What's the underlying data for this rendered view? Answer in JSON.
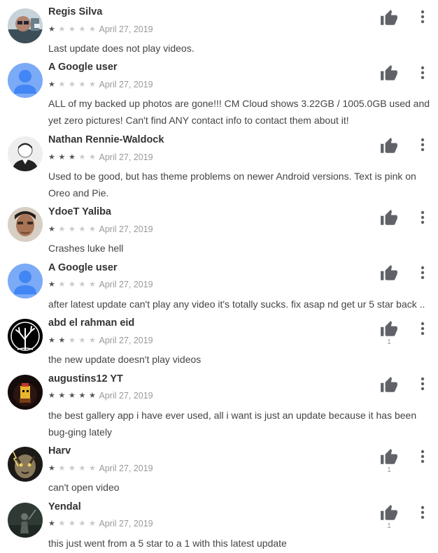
{
  "colors": {
    "author_text": "#333333",
    "body_text": "#444444",
    "date_text": "#9a9a9a",
    "star_filled": "#555555",
    "star_empty": "#c8c8c8",
    "icon": "#5f6368",
    "google_avatar_bg": "#7baaf7",
    "google_avatar_fg": "#4285f4"
  },
  "icons": {
    "thumb": "thumb-up-icon",
    "more": "more-vert-icon",
    "star_filled": "★",
    "star_empty": "★"
  },
  "reviews": [
    {
      "author": "Regis Silva",
      "rating": 1,
      "date": "April 27, 2019",
      "text": "Last update does not play videos.",
      "helpful_count": "",
      "avatar": "photo-man-glasses"
    },
    {
      "author": "A Google user",
      "rating": 1,
      "date": "April 27, 2019",
      "text": "ALL of my backed up photos are gone!!! CM Cloud shows 3.22GB / 1005.0GB used and yet zero pictures! Can't find ANY contact info to contact them about it!",
      "helpful_count": "",
      "avatar": "google-default"
    },
    {
      "author": "Nathan Rennie-Waldock",
      "rating": 3,
      "date": "April 27, 2019",
      "text": "Used to be good, but has theme problems on newer Android versions. Text is pink on Oreo and Pie.",
      "helpful_count": "",
      "avatar": "default-silhouette"
    },
    {
      "author": "YdoeT Yaliba",
      "rating": 1,
      "date": "April 27, 2019",
      "text": "Crashes luke hell",
      "helpful_count": "",
      "avatar": "photo-man-face"
    },
    {
      "author": "A Google user",
      "rating": 1,
      "date": "April 27, 2019",
      "text": "after latest update can't play any video it's totally sucks. fix asap nd get ur 5 star back ..",
      "helpful_count": "",
      "avatar": "google-default"
    },
    {
      "author": "abd el rahman eid",
      "rating": 2,
      "date": "April 27, 2019",
      "text": "the new update doesn't play videos",
      "helpful_count": "1",
      "avatar": "tree-logo"
    },
    {
      "author": "augustins12 YT",
      "rating": 5,
      "date": "April 27, 2019",
      "text": "the best gallery app i have ever used, all i want is just an update because it has been bug-ging lately",
      "helpful_count": "",
      "avatar": "dark-yellow-character"
    },
    {
      "author": "Harv",
      "rating": 1,
      "date": "April 27, 2019",
      "text": "can't open video",
      "helpful_count": "1",
      "avatar": "tiger-lightning"
    },
    {
      "author": "Yendal",
      "rating": 1,
      "date": "April 27, 2019",
      "text": "this just went from a 5 star to a 1 with this latest update",
      "helpful_count": "1",
      "avatar": "dark-figure"
    }
  ]
}
